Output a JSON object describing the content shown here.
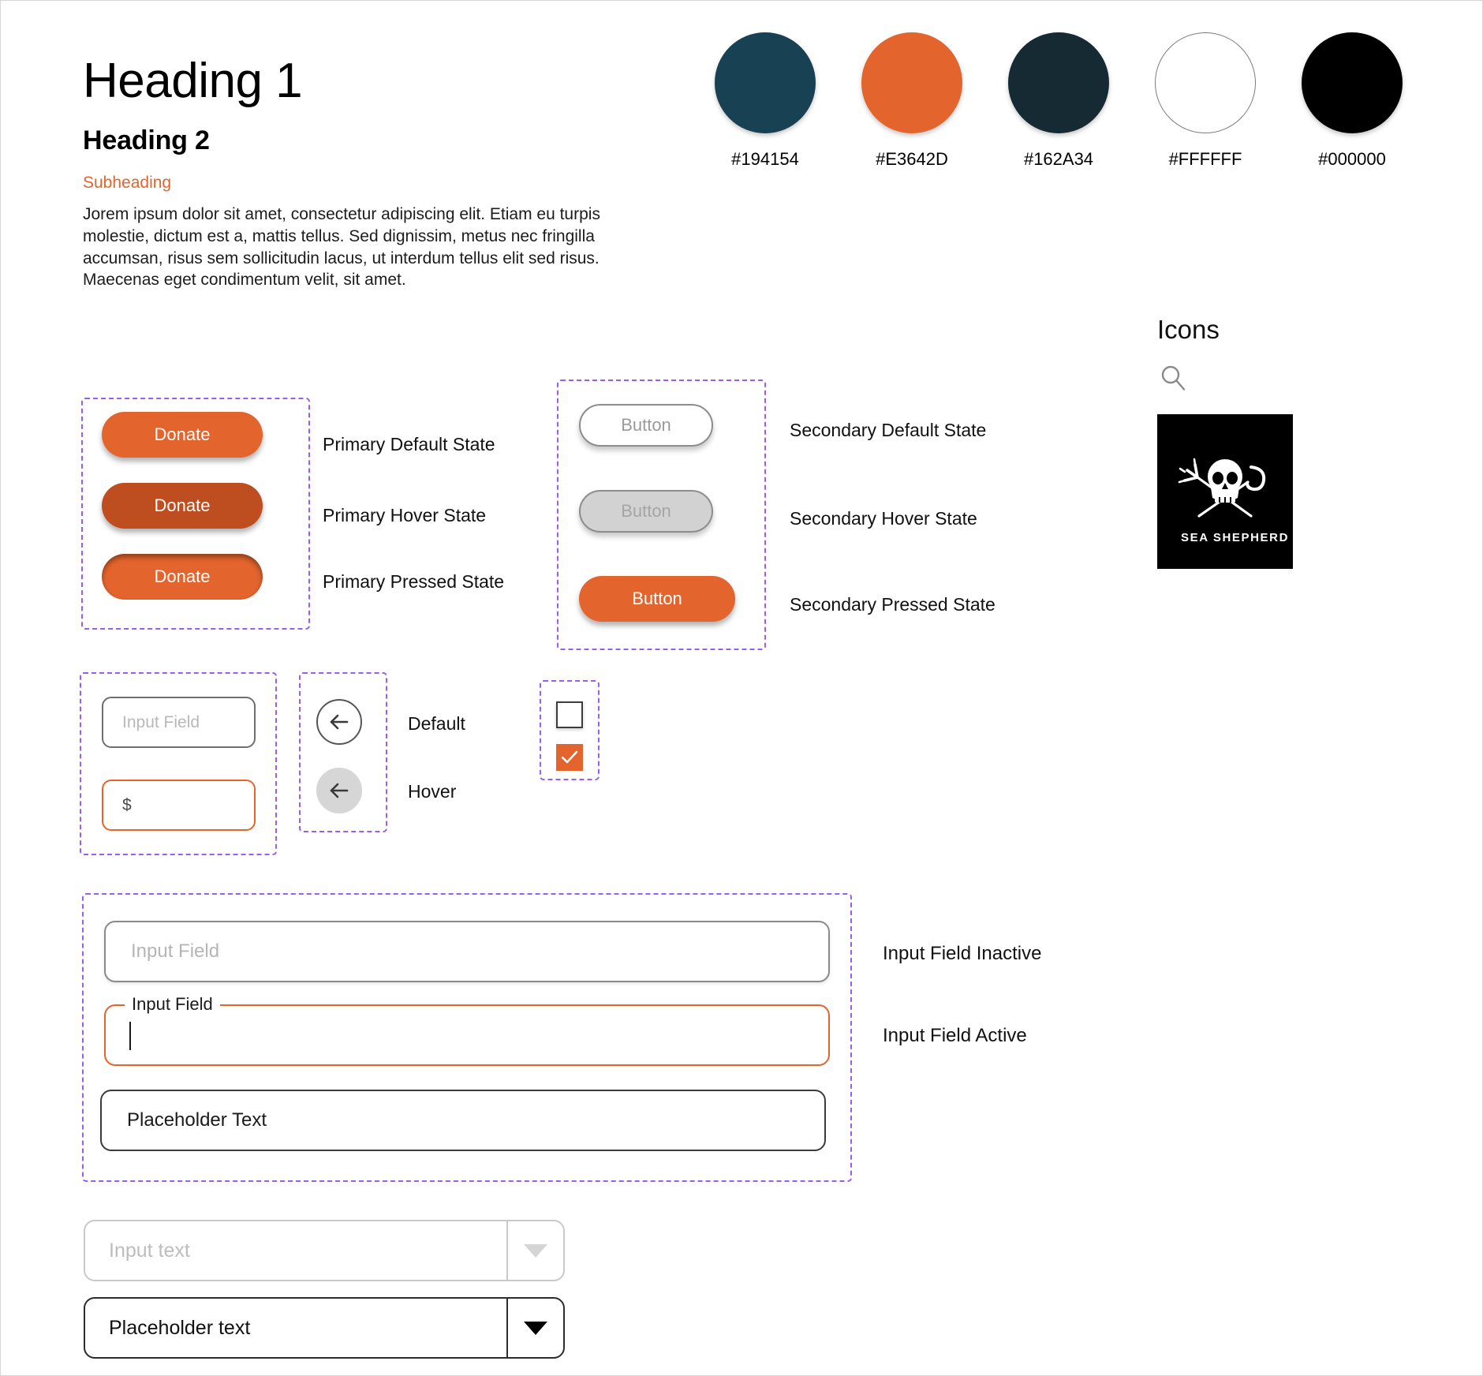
{
  "typography": {
    "h1": "Heading 1",
    "h2": "Heading 2",
    "subheading": "Subheading",
    "body": "Jorem ipsum dolor sit amet, consectetur adipiscing elit. Etiam eu turpis molestie, dictum est a, mattis tellus. Sed dignissim, metus nec fringilla accumsan, risus sem sollicitudin lacus, ut interdum tellus elit sed risus. Maecenas eget condimentum velit, sit amet."
  },
  "palette": [
    {
      "hex": "#194154",
      "label": "#194154"
    },
    {
      "hex": "#E3642D",
      "label": "#E3642D"
    },
    {
      "hex": "#162A34",
      "label": "#162A34"
    },
    {
      "hex": "#FFFFFF",
      "label": "#FFFFFF"
    },
    {
      "hex": "#000000",
      "label": "#000000"
    }
  ],
  "icons": {
    "title": "Icons",
    "search_icon": "search-icon",
    "logo_name": "sea-shepherd-logo",
    "logo_wordmark": "SEA SHEPHERD"
  },
  "buttons": {
    "primary": {
      "label": "Donate",
      "states": [
        {
          "label": "Donate",
          "state_label": "Primary Default State"
        },
        {
          "label": "Donate",
          "state_label": "Primary Hover State"
        },
        {
          "label": "Donate",
          "state_label": "Primary Pressed State"
        }
      ]
    },
    "secondary": {
      "label": "Button",
      "states": [
        {
          "label": "Button",
          "state_label": "Secondary Default State"
        },
        {
          "label": "Button",
          "state_label": "Secondary Hover State"
        },
        {
          "label": "Button",
          "state_label": "Secondary Pressed State"
        }
      ]
    }
  },
  "small_inputs": {
    "default_placeholder": "Input Field",
    "currency_value": "$"
  },
  "arrow_buttons": {
    "icon": "arrow-left-icon",
    "default_label": "Default",
    "hover_label": "Hover"
  },
  "checkboxes": {
    "unchecked_name": "checkbox-unchecked",
    "checked_name": "checkbox-checked",
    "check_glyph": "✓"
  },
  "large_inputs": {
    "inactive": {
      "placeholder": "Input Field",
      "caption": "Input Field Inactive"
    },
    "active": {
      "floating_label": "Input Field",
      "value": "",
      "caption": "Input Field Active"
    },
    "filled": {
      "value": "Placeholder Text"
    }
  },
  "selects": {
    "light": {
      "value": "Input text",
      "arrow": "chevron-down-icon"
    },
    "dark": {
      "value": "Placeholder text",
      "arrow": "chevron-down-icon"
    }
  }
}
